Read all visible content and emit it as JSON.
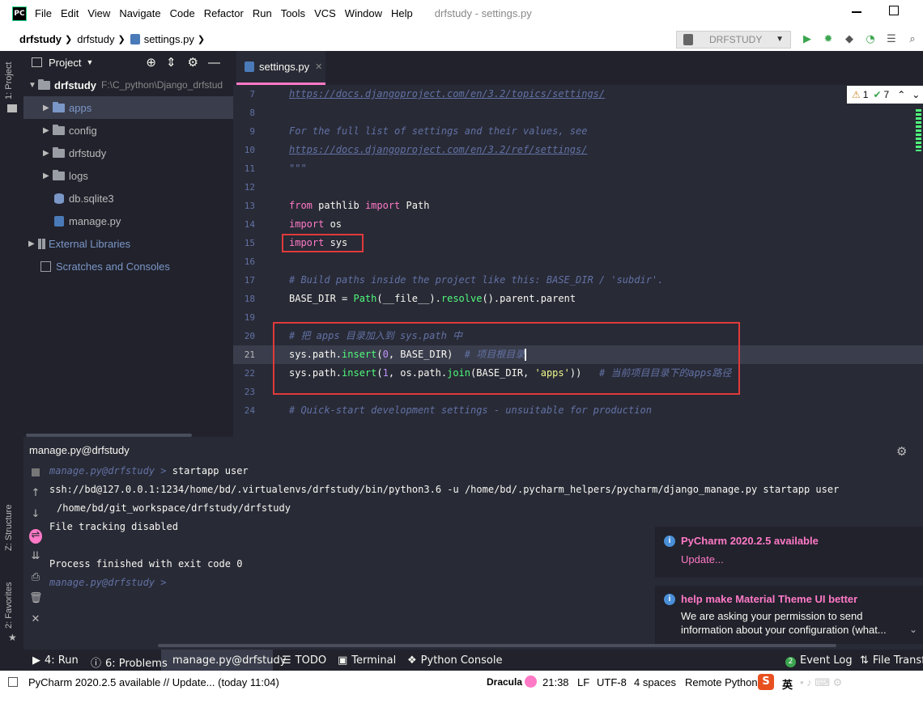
{
  "menu": {
    "logo": "PC",
    "items": [
      "File",
      "Edit",
      "View",
      "Navigate",
      "Code",
      "Refactor",
      "Run",
      "Tools",
      "VCS",
      "Window",
      "Help"
    ],
    "window_title": "drfstudy - settings.py"
  },
  "navbar": {
    "crumbs": [
      "drfstudy",
      "drfstudy",
      "settings.py"
    ],
    "run_config": "DRFSTUDY"
  },
  "left_strip": {
    "project_tab": "1: Project",
    "structure_tab": "Z: Structure",
    "favorites_tab": "2: Favorites"
  },
  "project_panel": {
    "title": "Project",
    "root_name": "drfstudy",
    "root_path": "F:\\C_python\\Django_drfstud",
    "items": [
      "apps",
      "config",
      "drfstudy",
      "logs",
      "db.sqlite3",
      "manage.py",
      "External Libraries",
      "Scratches and Consoles"
    ]
  },
  "editor": {
    "tab_label": "settings.py",
    "inspection_warnings": "1",
    "inspection_ok": "7",
    "line_numbers": [
      "7",
      "8",
      "9",
      "10",
      "11",
      "12",
      "13",
      "14",
      "15",
      "16",
      "17",
      "18",
      "19",
      "20",
      "21",
      "22",
      "23",
      "24"
    ],
    "line7": "https://docs.djangoproject.com/en/3.2/topics/settings/",
    "line9": "For the full list of settings and their values, see",
    "line10": "https://docs.djangoproject.com/en/3.2/ref/settings/",
    "line11": "\"\"\"",
    "line13_kw1": "from",
    "line13_mod": " pathlib ",
    "line13_kw2": "import",
    "line13_name": " Path",
    "line14_kw": "import",
    "line14_name": " os",
    "line15_kw": "import",
    "line15_name": " sys",
    "line17": "# Build paths inside the project like this: BASE_DIR / 'subdir'.",
    "line18_a": "BASE_DIR = ",
    "line18_b": "Path",
    "line18_c": "(__file__).",
    "line18_d": "resolve",
    "line18_e": "().parent.parent",
    "line20": "# 把 apps 目录加入到 sys.path 中",
    "line21_a": "sys.path.",
    "line21_b": "insert",
    "line21_c": "(",
    "line21_d": "0",
    "line21_e": ", BASE_DIR)",
    "line21_f": "  # 项目根目录",
    "line22_a": "sys.path.",
    "line22_b": "insert",
    "line22_c": "(",
    "line22_d": "1",
    "line22_e": ", os.path.",
    "line22_f": "join",
    "line22_g": "(BASE_DIR, ",
    "line22_h": "'apps'",
    "line22_i": "))",
    "line22_j": "   # 当前项目目录下的apps路径",
    "line24": "# Quick-start development settings - unsuitable for production"
  },
  "run_panel": {
    "title": "manage.py@drfstudy",
    "prompt": "manage.py@drfstudy >",
    "cmd1": " startapp user",
    "out_ssh": "ssh://bd@127.0.0.1:1234/home/bd/.virtualenvs/drfstudy/bin/python3.6 -u /home/bd/.pycharm_helpers/pycharm/django_manage.py startapp user",
    "out_path": "/home/bd/git_workspace/drfstudy/drfstudy",
    "out_tracking": "File tracking disabled",
    "out_finished": "Process finished with exit code 0",
    "prompt2": "manage.py@drfstudy >"
  },
  "notifications": [
    {
      "title": "PyCharm 2020.2.5 available",
      "link": "Update..."
    },
    {
      "title": "help make Material Theme UI better",
      "line1": "We are asking your permission to send",
      "line2": "information about your configuration (what..."
    }
  ],
  "bottom_tabs": {
    "run": "4: Run",
    "problems": "6: Problems",
    "manage": "manage.py@drfstudy",
    "todo": "TODO",
    "terminal": "Terminal",
    "python_console": "Python Console",
    "event_log": "Event Log",
    "event_log_count": "2",
    "file_transfer": "File Transfer"
  },
  "status_bar": {
    "message": "PyCharm 2020.2.5 available // Update... (today 11:04)",
    "theme": "Dracula",
    "position": "21:38",
    "line_sep": "LF",
    "encoding": "UTF-8",
    "indent": "4 spaces",
    "interpreter": "Remote Python",
    "ime": "英",
    "ime_logo": "S"
  },
  "colors": {
    "pink": "#ff79c6",
    "green": "#50fa7b",
    "comment": "#6272a4",
    "bg": "#282a36",
    "highlight_box": "#e03a3a"
  }
}
